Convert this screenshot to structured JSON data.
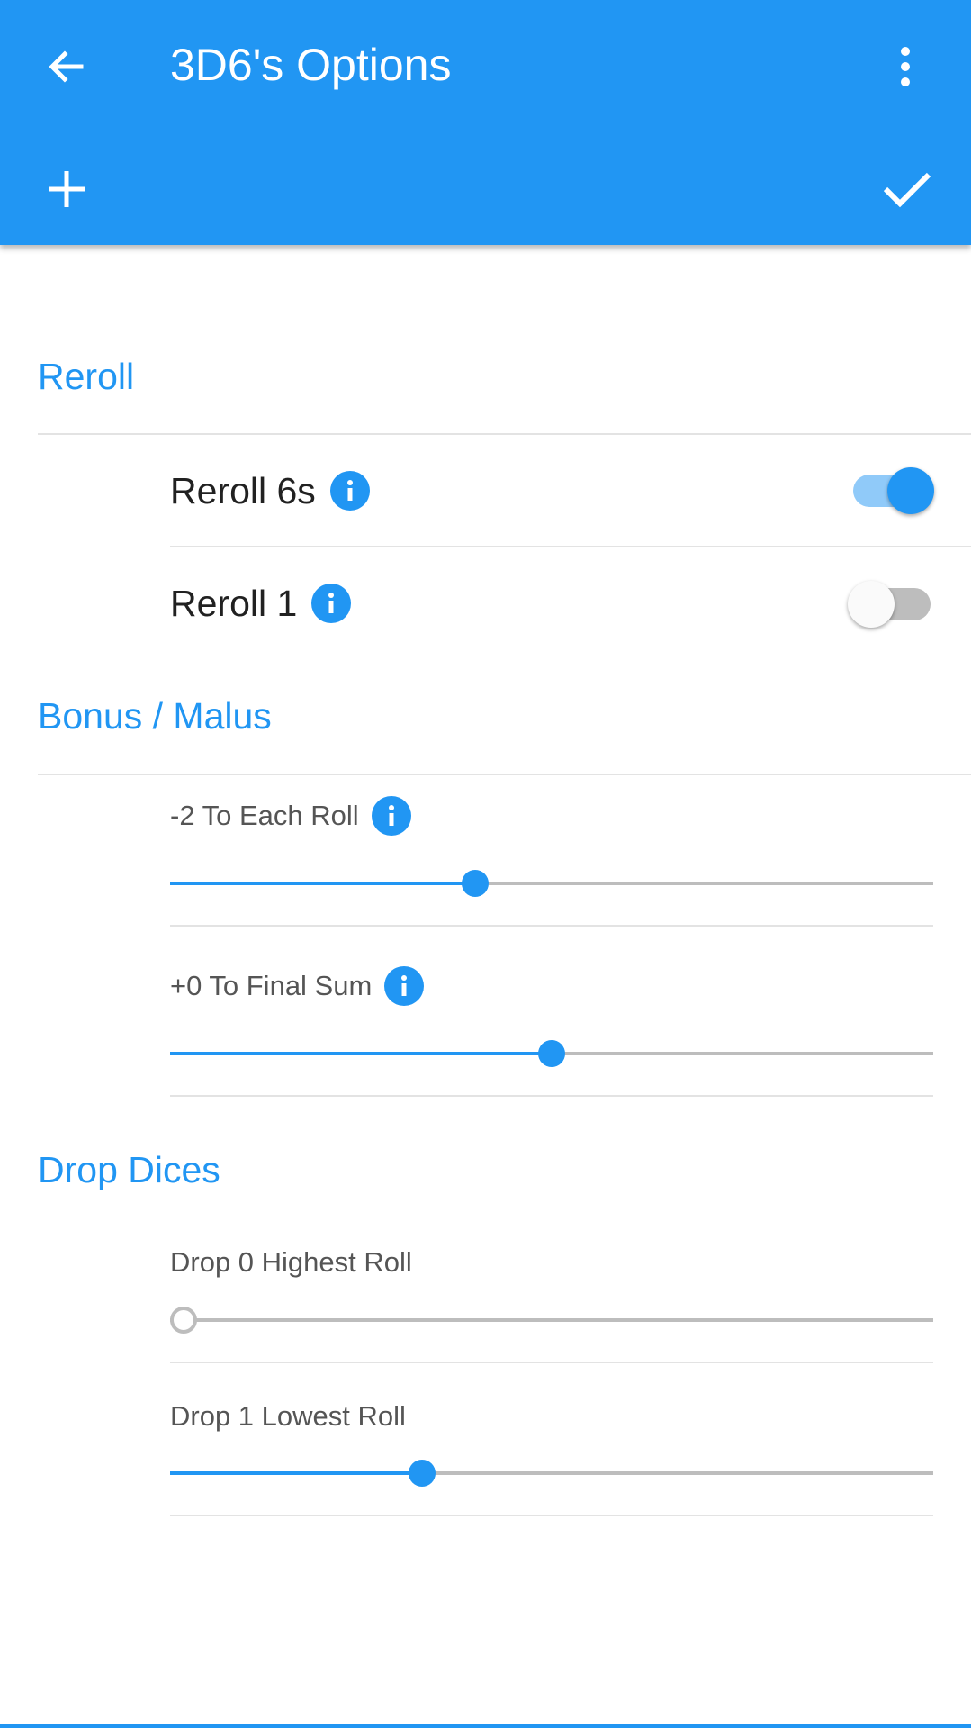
{
  "appbar": {
    "title": "3D6's Options",
    "back_icon": "arrow-left-icon",
    "menu_icon": "more-vertical-icon",
    "add_icon": "plus-icon",
    "confirm_icon": "checkmark-icon"
  },
  "colors": {
    "primary": "#2196F3",
    "primary_light": "#90CAF9",
    "switch_off_track": "#bdbdbd",
    "rail": "#bdbdbd"
  },
  "sections": {
    "reroll": {
      "header": "Reroll",
      "items": [
        {
          "label": "Reroll 6s",
          "enabled": true,
          "info_icon": "info-icon"
        },
        {
          "label": "Reroll 1",
          "enabled": false,
          "info_icon": "info-icon"
        }
      ]
    },
    "bonus_malus": {
      "header": "Bonus / Malus",
      "sliders": [
        {
          "label": "-2 To Each Roll",
          "level_percent": 40,
          "info_icon": "info-icon"
        },
        {
          "label": "+0 To Final Sum",
          "level_percent": 50,
          "info_icon": "info-icon"
        }
      ]
    },
    "drop_dices": {
      "header": "Drop Dices",
      "sliders": [
        {
          "label": "Drop 0 Highest Roll",
          "level_percent": 0
        },
        {
          "label": "Drop 1 Lowest Roll",
          "level_percent": 33
        }
      ]
    }
  }
}
